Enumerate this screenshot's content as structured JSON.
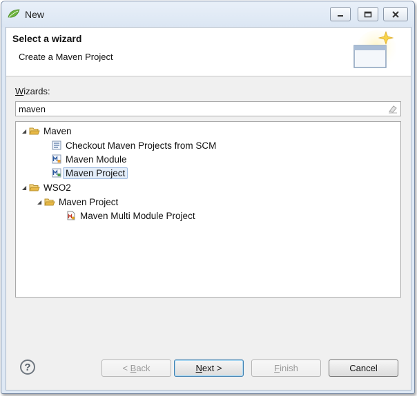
{
  "window": {
    "title": "New",
    "controls": [
      "minimize-icon",
      "maximize-icon",
      "close-icon"
    ]
  },
  "header": {
    "title": "Select a wizard",
    "subtitle": "Create a Maven Project"
  },
  "wizards_label": {
    "mnemonic": "W",
    "rest": "izards:"
  },
  "filter": {
    "value": "maven"
  },
  "tree": {
    "nodes": [
      {
        "label": "Maven",
        "icon": "folder-open-icon",
        "expanded": true
      },
      {
        "label": "Checkout Maven Projects from SCM",
        "icon": "checkout-icon"
      },
      {
        "label": "Maven Module",
        "icon": "maven-module-icon"
      },
      {
        "label": "Maven Project",
        "icon": "maven-project-icon",
        "selected": true
      },
      {
        "label": "WSO2",
        "icon": "folder-open-icon",
        "expanded": true
      },
      {
        "label": "Maven Project",
        "icon": "folder-open-icon",
        "expanded": true
      },
      {
        "label": "Maven Multi Module Project",
        "icon": "multi-module-icon"
      }
    ]
  },
  "buttons": {
    "back": {
      "mnemonic": "B",
      "prefix": "< ",
      "rest": "ack",
      "enabled": false
    },
    "next": {
      "mnemonic": "N",
      "rest": "ext >",
      "enabled": true
    },
    "finish": {
      "mnemonic": "F",
      "rest": "inish",
      "enabled": false
    },
    "cancel": {
      "label": "Cancel",
      "enabled": true
    }
  },
  "colors": {
    "title_bar": "#dbe6f3",
    "dialog_bg": "#f0f0f0",
    "selection": "#e3edf9",
    "default_button_border": "#3c7fb1",
    "folder": "#e8b947"
  }
}
